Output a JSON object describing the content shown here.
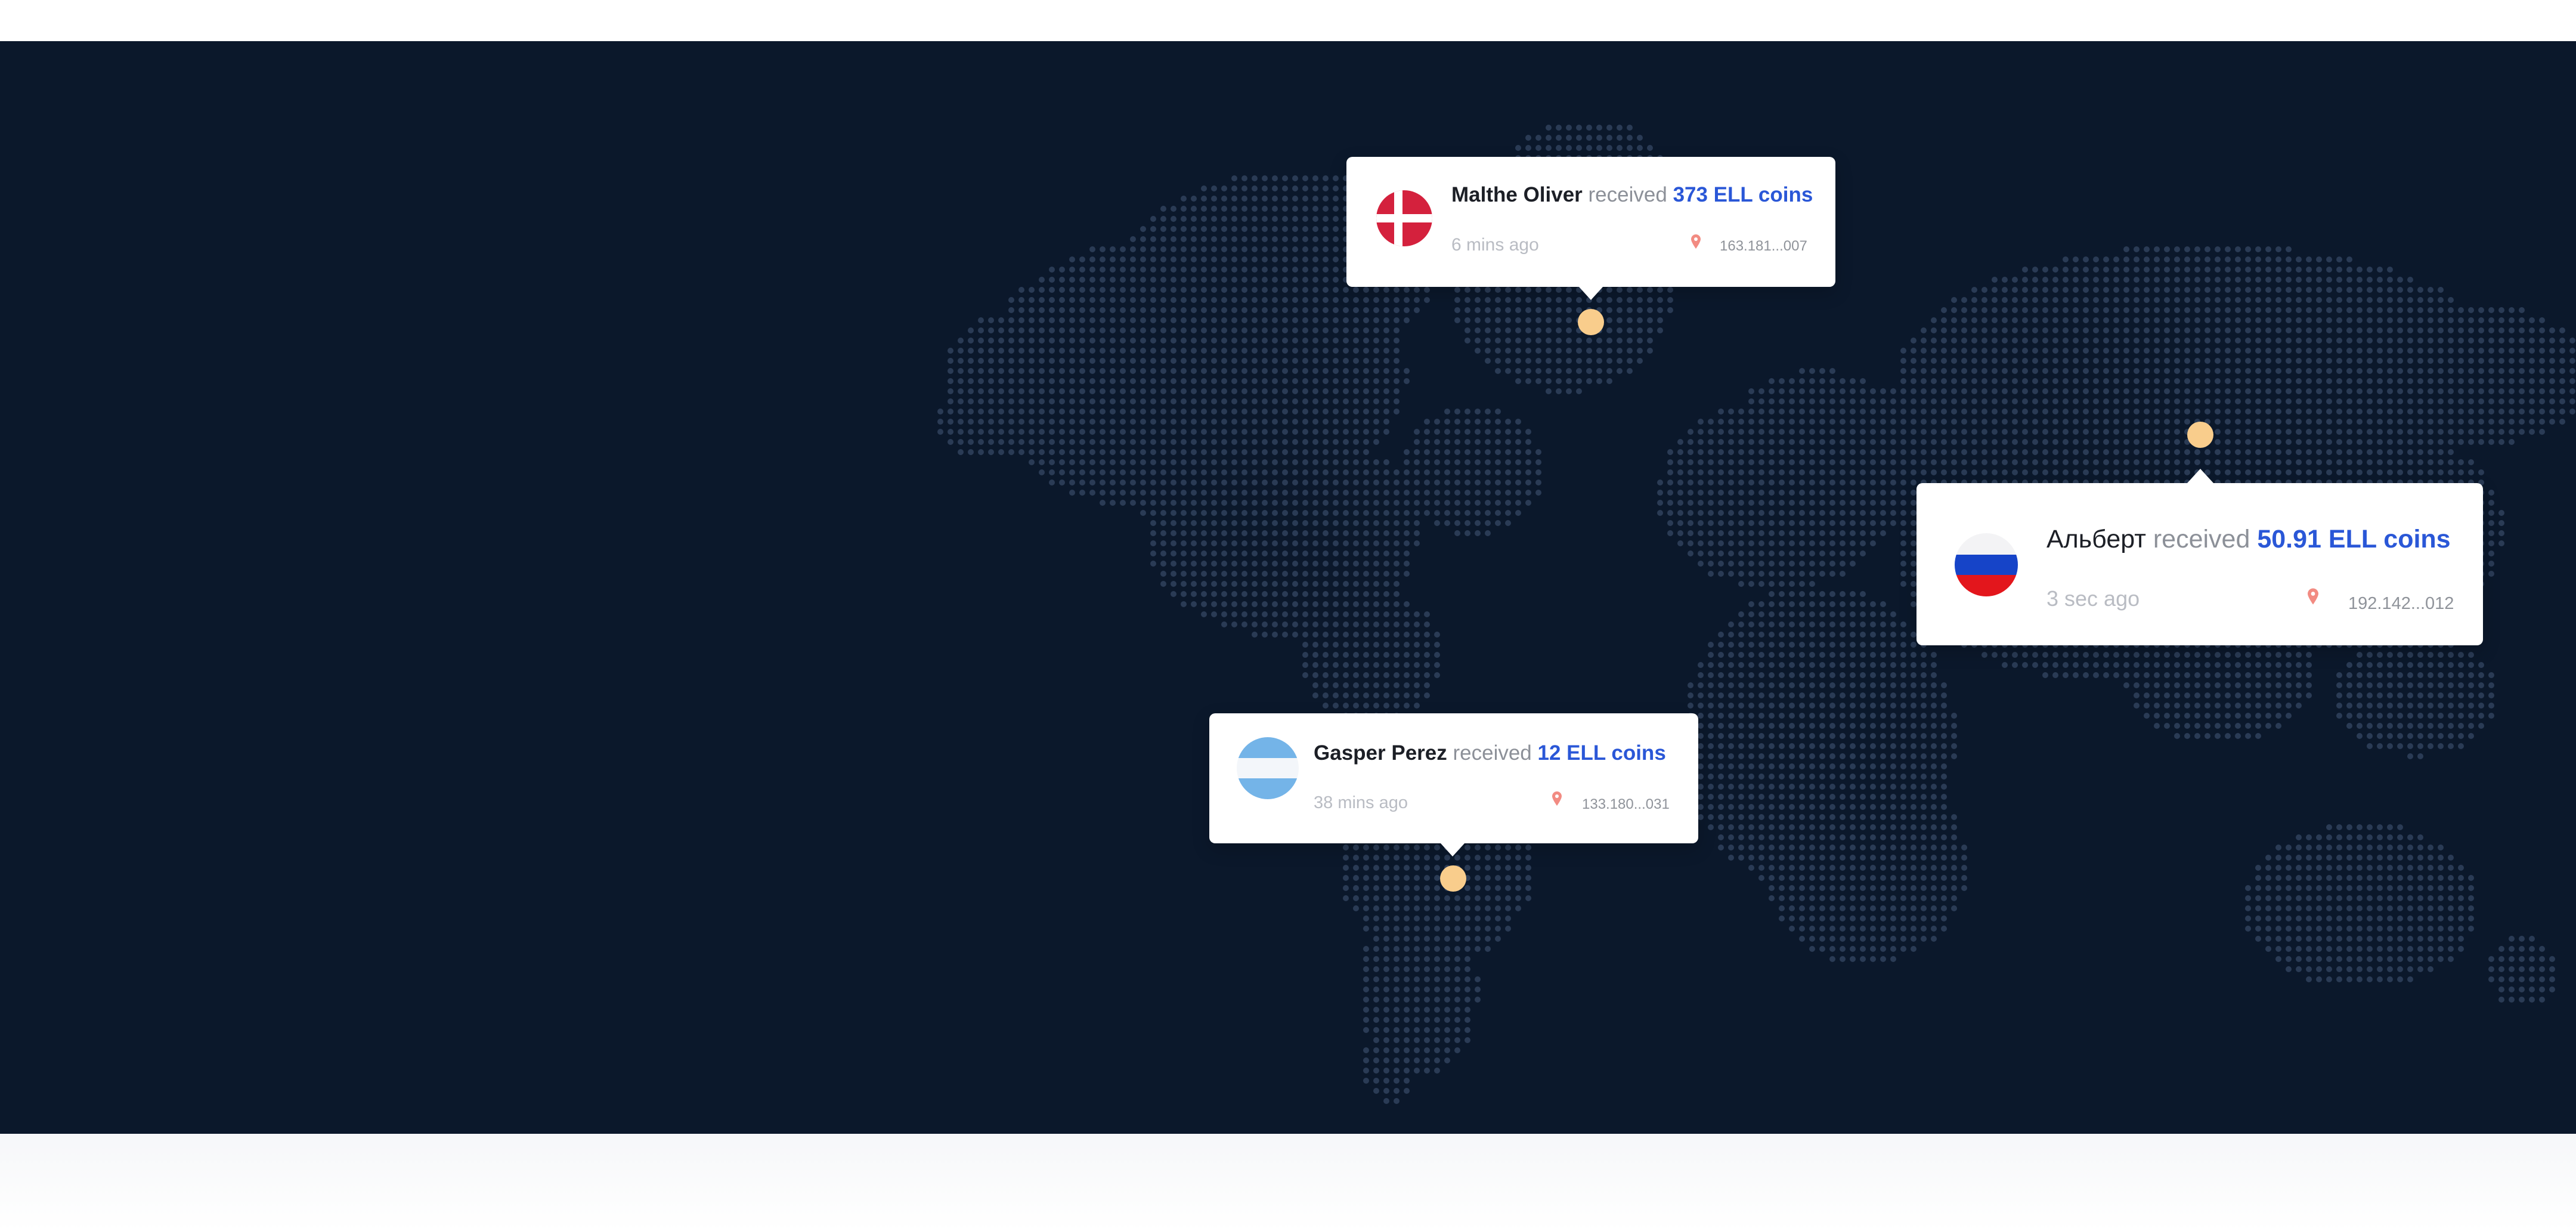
{
  "map": {
    "background_color": "#0b182b",
    "dot_color": "#2a3b55",
    "pin_color": "#f9cd8c"
  },
  "notifications": [
    {
      "id": "denmark",
      "flag_icon": "denmark-flag-icon",
      "name": "Malthe Oliver",
      "verb": "received",
      "amount": "373 ELL coins",
      "time": "6 mins ago",
      "location_icon": "map-pin-icon",
      "ip": "163.181...007"
    },
    {
      "id": "russia",
      "flag_icon": "russia-flag-icon",
      "name": "Альберт",
      "verb": "received",
      "amount": "50.91 ELL coins",
      "time": "3 sec ago",
      "location_icon": "map-pin-icon",
      "ip": "192.142...012"
    },
    {
      "id": "argentina",
      "flag_icon": "argentina-flag-icon",
      "name": "Gasper Perez",
      "verb": "received",
      "amount": "12 ELL coins",
      "time": "38 mins ago",
      "location_icon": "map-pin-icon",
      "ip": "133.180...031"
    }
  ],
  "colors": {
    "amount": "#2a57d7",
    "verb": "#8c9098",
    "time": "#b9bcc3",
    "ip": "#8f939a",
    "pin_icon": "#f28b82"
  }
}
